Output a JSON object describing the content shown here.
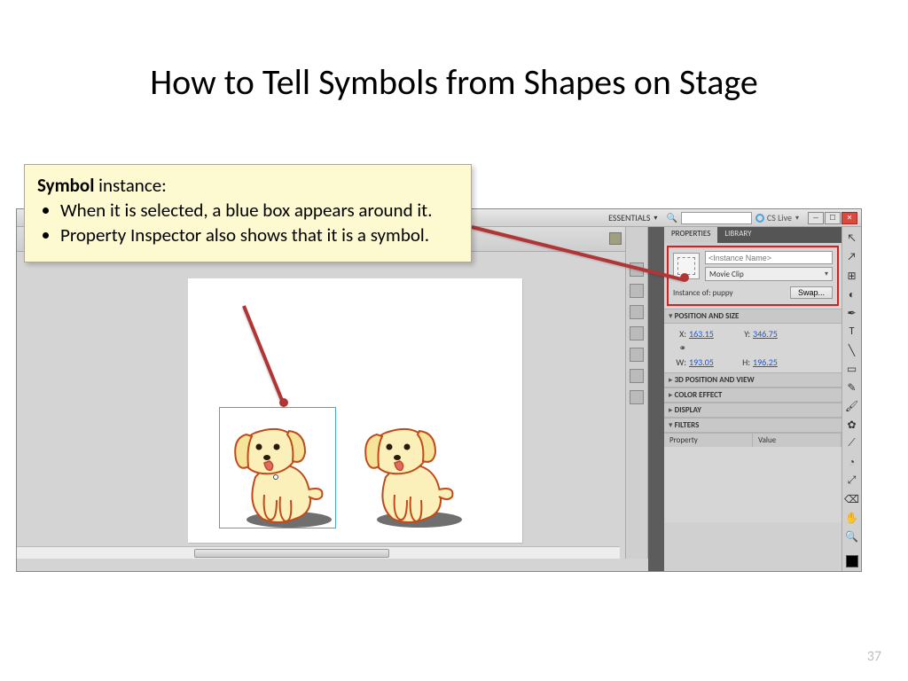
{
  "slide": {
    "title": "How to Tell Symbols from Shapes on Stage",
    "page_number": "37"
  },
  "callout": {
    "title_bold": "Symbol",
    "title_rest": " instance:",
    "bullet1": "When it is selected, a blue box appears around it.",
    "bullet2": "Property Inspector also shows that it is a symbol."
  },
  "topbar": {
    "workspace": "ESSENTIALS",
    "search_placeholder": "",
    "search_icon": "🔍",
    "cslive": "CS Live"
  },
  "panel": {
    "tab_properties": "PROPERTIES",
    "tab_library": "LIBRARY",
    "instance_name_placeholder": "<Instance Name>",
    "symbol_type": "Movie Clip",
    "instance_of_label": "Instance of:",
    "instance_of_value": "puppy",
    "swap_label": "Swap...",
    "section_pos": "POSITION AND SIZE",
    "x_label": "X:",
    "x_value": "163.15",
    "y_label": "Y:",
    "y_value": "346.75",
    "w_label": "W:",
    "w_value": "193.05",
    "h_label": "H:",
    "h_value": "196.25",
    "lock_icon": "⚭",
    "section_3d": "3D POSITION AND VIEW",
    "section_color": "COLOR EFFECT",
    "section_display": "DISPLAY",
    "section_filters": "FILTERS",
    "filters_col_property": "Property",
    "filters_col_value": "Value"
  }
}
